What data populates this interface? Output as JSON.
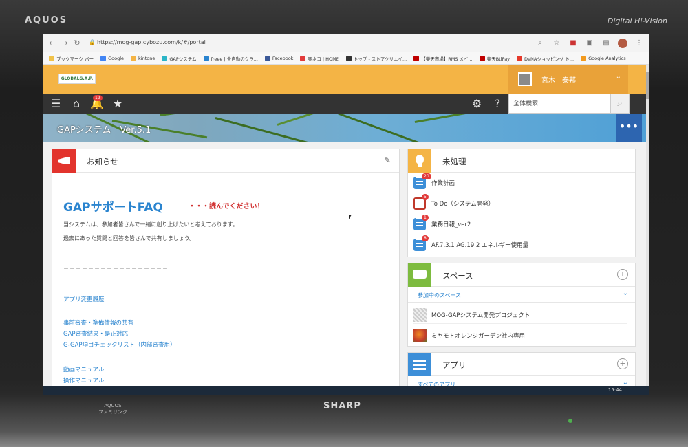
{
  "tv": {
    "brand": "AQUOS",
    "tagline": "Digital Hi-Vision",
    "bottom_brand": "SHARP",
    "bottom_series": "AQUOS",
    "bottom_sub": "ファミリンク"
  },
  "browser": {
    "url": "https://mog-gap.cybozu.com/k/#/portal",
    "bookmarks": [
      {
        "label": "ブックマーク バー",
        "color": "#f0c24a"
      },
      {
        "label": "Google",
        "color": "#4285f4"
      },
      {
        "label": "kintone",
        "color": "#f4b445"
      },
      {
        "label": "GAPシステム",
        "color": "#2bb5c7"
      },
      {
        "label": "freee | 全自動のクラ...",
        "color": "#2a84cf"
      },
      {
        "label": "Facebook",
        "color": "#3b5998"
      },
      {
        "label": "楽ネコ | HOME",
        "color": "#e23b3b"
      },
      {
        "label": "トップ - ストアクリエイ...",
        "color": "#333333"
      },
      {
        "label": "【楽天市場】RMS メイ...",
        "color": "#bf0000"
      },
      {
        "label": "楽天BtlPay",
        "color": "#bf0000"
      },
      {
        "label": "DeNAショッピング ト...",
        "color": "#e5392b"
      },
      {
        "label": "Google Analytics",
        "color": "#f29a1e"
      }
    ]
  },
  "header": {
    "logo": "GLOBALG.A.P.",
    "user_name": "宮木　泰邦",
    "search_placeholder": "全体検索",
    "notification_count": "19"
  },
  "banner": {
    "title": "GAPシステム　Ver.5.1"
  },
  "notice": {
    "title": "お知らせ",
    "faq_title": "GAPサポートFAQ",
    "faq_note": "・・・読んでください！",
    "para1": "当システムは、参加者皆さんで一緒に創り上げたいと考えております。",
    "para2": "過去にあった質問と回答を皆さんで共有しましょう。",
    "divider": "＝＝＝＝＝＝＝＝＝＝＝＝＝＝＝＝＝",
    "links": [
      "アプリ変更履歴",
      "事前審査・準備情報の共有",
      "GAP審査結果・是正対応",
      "G-GAP項目チェックリスト（内部審査用）",
      "動画マニュアル",
      "操作マニュアル"
    ]
  },
  "pending": {
    "title": "未処理",
    "items": [
      {
        "label": "作業計画",
        "count": "20"
      },
      {
        "label": "To Do（システム開発）",
        "count": "5"
      },
      {
        "label": "業務日報_ver2",
        "count": "1"
      },
      {
        "label": "AF.7.3.1 AG.19.2 エネルギー使用量",
        "count": "8"
      }
    ]
  },
  "spaces": {
    "title": "スペース",
    "subheader": "参加中のスペース",
    "items": [
      "MOG-GAPシステム開発プロジェクト",
      "ミヤモトオレンジガーデン社内専用"
    ]
  },
  "apps": {
    "title": "アプリ",
    "subheader": "すべてのアプリ"
  },
  "taskbar": {
    "time": "15:44"
  }
}
